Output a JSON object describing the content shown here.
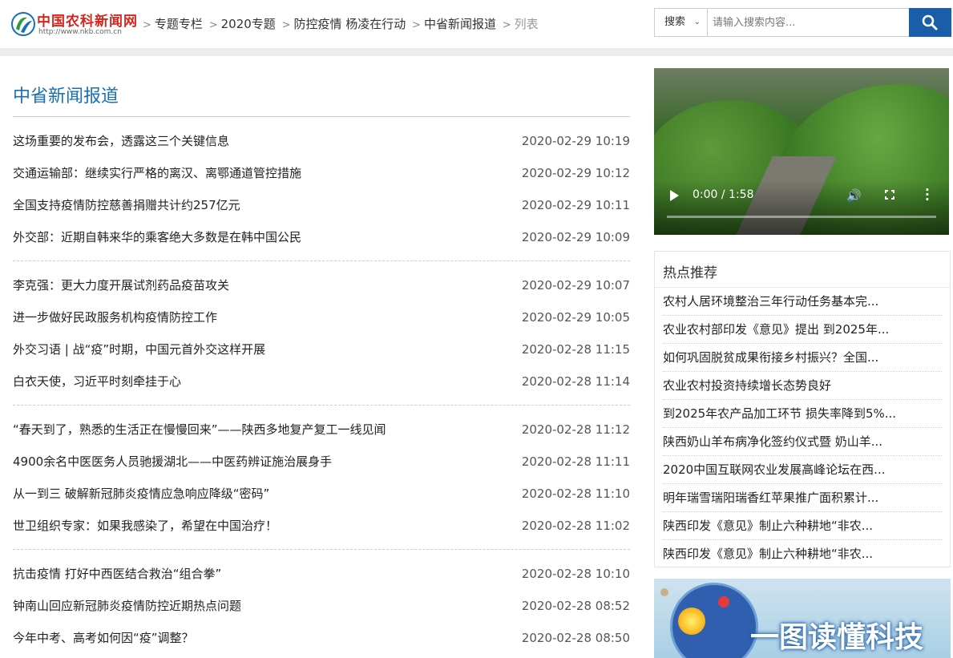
{
  "header": {
    "logo_text": "中国农科新闻网",
    "logo_url": "http://www.nkb.com.cn",
    "breadcrumb": [
      "专题专栏",
      "2020专题",
      "防控疫情 杨凌在行动",
      "中省新闻报道"
    ],
    "breadcrumb_current": "列表",
    "search": {
      "select_label": "搜索",
      "placeholder": "请输入搜索内容...",
      "button_icon": "search-icon"
    }
  },
  "main": {
    "section_title": "中省新闻报道",
    "groups": [
      [
        {
          "title": "这场重要的发布会，透露这三个关键信息",
          "date": "2020-02-29 10:19"
        },
        {
          "title": "交通运输部：继续实行严格的离汉、离鄂通道管控措施",
          "date": "2020-02-29 10:12"
        },
        {
          "title": "全国支持疫情防控慈善捐赠共计约257亿元",
          "date": "2020-02-29 10:11"
        },
        {
          "title": "外交部：近期自韩来华的乘客绝大多数是在韩中国公民",
          "date": "2020-02-29 10:09"
        }
      ],
      [
        {
          "title": "李克强：更大力度开展试剂药品疫苗攻关",
          "date": "2020-02-29 10:07"
        },
        {
          "title": "进一步做好民政服务机构疫情防控工作",
          "date": "2020-02-29 10:05"
        },
        {
          "title": "外交习语 | 战“疫”时期，中国元首外交这样开展",
          "date": "2020-02-28 11:15"
        },
        {
          "title": "白衣天使，习近平时刻牵挂于心",
          "date": "2020-02-28 11:14"
        }
      ],
      [
        {
          "title": "“春天到了，熟悉的生活正在慢慢回来”——陕西多地复产复工一线见闻",
          "date": "2020-02-28 11:12"
        },
        {
          "title": "4900余名中医医务人员驰援湖北——中医药辨证施治展身手",
          "date": "2020-02-28 11:11"
        },
        {
          "title": "从一到三 破解新冠肺炎疫情应急响应降级“密码”",
          "date": "2020-02-28 11:10"
        },
        {
          "title": "世卫组织专家：如果我感染了，希望在中国治疗！",
          "date": "2020-02-28 11:02"
        }
      ],
      [
        {
          "title": "抗击疫情 打好中西医结合救治“组合拳”",
          "date": "2020-02-28 10:10"
        },
        {
          "title": "钟南山回应新冠肺炎疫情防控近期热点问题",
          "date": "2020-02-28 08:52"
        },
        {
          "title": "今年中考、高考如何因“疫”调整？",
          "date": "2020-02-28 08:50"
        }
      ]
    ]
  },
  "sidebar": {
    "video": {
      "time": "0:00 / 1:58",
      "progress": 0
    },
    "hot_title": "热点推荐",
    "hot_items": [
      "农村人居环境整治三年行动任务基本完...",
      "农业农村部印发《意见》提出 到2025年...",
      "如何巩固脱贫成果衔接乡村振兴？全国...",
      "农业农村投资持续增长态势良好",
      "到2025年农产品加工环节 损失率降到5%...",
      "陕西奶山羊布病净化签约仪式暨 奶山羊...",
      "2020中国互联网农业发展高峰论坛在西...",
      "明年瑞雪瑞阳瑞香红苹果推广面积累计...",
      "陕西印发《意见》制止六种耕地“非农...",
      "陕西印发《意见》制止六种耕地“非农..."
    ],
    "banner_text": "一图读懂科技"
  },
  "colors": {
    "accent": "#1a6fb4",
    "search_button": "#1a5da8",
    "logo_red": "#d8251d"
  }
}
